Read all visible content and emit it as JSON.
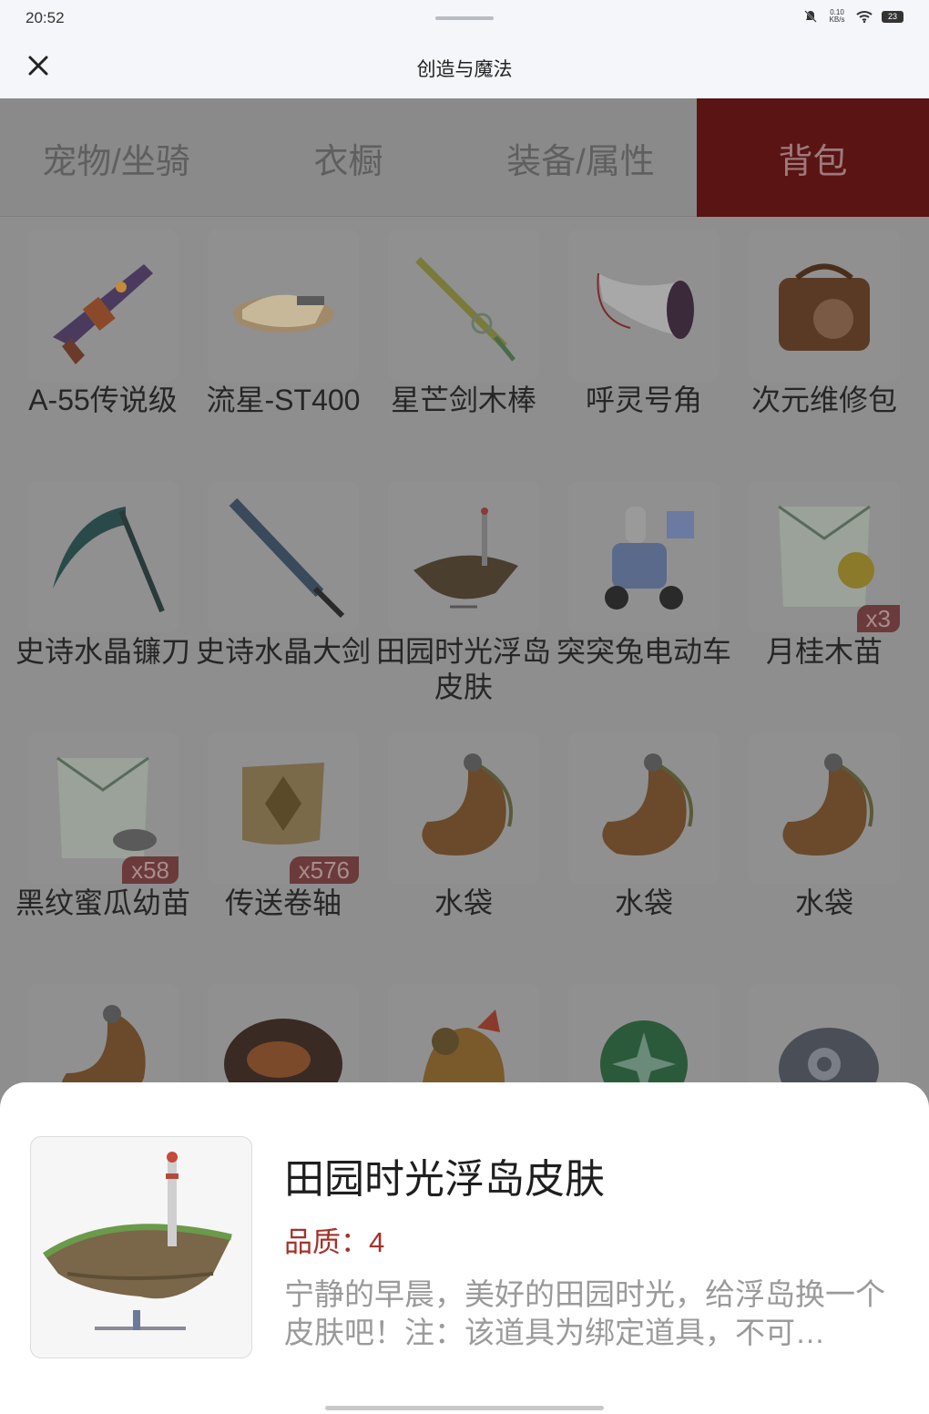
{
  "status_bar": {
    "time": "20:52",
    "net_speed": "0.10 KB/s",
    "battery": "23"
  },
  "header": {
    "title": "创造与魔法"
  },
  "tabs": [
    {
      "label": "宠物/坐骑",
      "active": false
    },
    {
      "label": "衣橱",
      "active": false
    },
    {
      "label": "装备/属性",
      "active": false
    },
    {
      "label": "背包",
      "active": true
    }
  ],
  "items": [
    {
      "name": "A-55传说级",
      "icon": "gun-icon"
    },
    {
      "name": "流星-ST400",
      "icon": "hover-bike-icon"
    },
    {
      "name": "星芒剑木棒",
      "icon": "sword-icon"
    },
    {
      "name": "呼灵号角",
      "icon": "horn-icon"
    },
    {
      "name": "次元维修包",
      "icon": "repair-bag-icon"
    },
    {
      "name": "史诗水晶镰刀",
      "icon": "scythe-icon"
    },
    {
      "name": "史诗水晶大剑",
      "icon": "greatsword-icon"
    },
    {
      "name": "田园时光浮岛皮肤",
      "icon": "floating-island-icon"
    },
    {
      "name": "突突兔电动车",
      "icon": "scooter-icon"
    },
    {
      "name": "月桂木苗",
      "icon": "seed-pack-icon",
      "qty": "x3"
    },
    {
      "name": "黑纹蜜瓜幼苗",
      "icon": "seed-pack-icon",
      "qty": "x58"
    },
    {
      "name": "传送卷轴",
      "icon": "scroll-icon",
      "qty": "x576"
    },
    {
      "name": "水袋",
      "icon": "water-bag-icon"
    },
    {
      "name": "水袋",
      "icon": "water-bag-icon"
    },
    {
      "name": "水袋",
      "icon": "water-bag-icon"
    },
    {
      "name": "",
      "icon": "water-bag-icon"
    },
    {
      "name": "",
      "icon": "food-plate-icon"
    },
    {
      "name": "",
      "icon": "dragon-icon"
    },
    {
      "name": "",
      "icon": "green-orb-icon"
    },
    {
      "name": "",
      "icon": "stone-disc-icon"
    }
  ],
  "detail": {
    "name": "田园时光浮岛皮肤",
    "quality": "品质：4",
    "description": "宁静的早晨，美好的田园时光，给浮岛换一个皮肤吧！注：该道具为绑定道具，不可…",
    "icon": "floating-island-icon"
  }
}
